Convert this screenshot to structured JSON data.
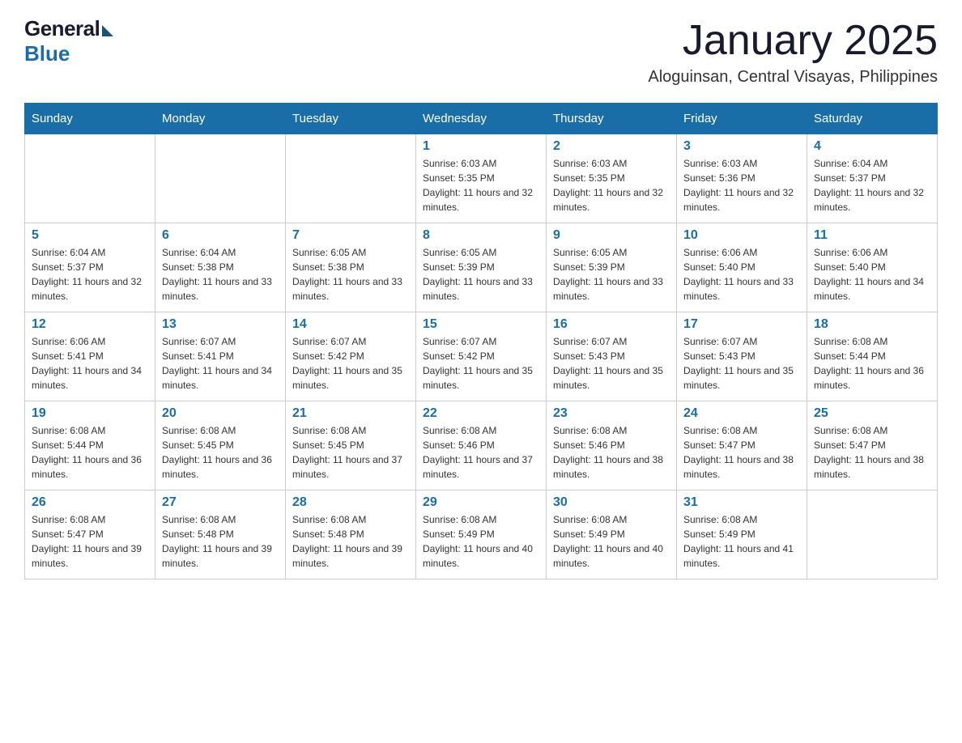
{
  "logo": {
    "general": "General",
    "blue": "Blue"
  },
  "header": {
    "month_year": "January 2025",
    "location": "Aloguinsan, Central Visayas, Philippines"
  },
  "weekdays": [
    "Sunday",
    "Monday",
    "Tuesday",
    "Wednesday",
    "Thursday",
    "Friday",
    "Saturday"
  ],
  "weeks": [
    [
      {
        "day": "",
        "sunrise": "",
        "sunset": "",
        "daylight": ""
      },
      {
        "day": "",
        "sunrise": "",
        "sunset": "",
        "daylight": ""
      },
      {
        "day": "",
        "sunrise": "",
        "sunset": "",
        "daylight": ""
      },
      {
        "day": "1",
        "sunrise": "Sunrise: 6:03 AM",
        "sunset": "Sunset: 5:35 PM",
        "daylight": "Daylight: 11 hours and 32 minutes."
      },
      {
        "day": "2",
        "sunrise": "Sunrise: 6:03 AM",
        "sunset": "Sunset: 5:35 PM",
        "daylight": "Daylight: 11 hours and 32 minutes."
      },
      {
        "day": "3",
        "sunrise": "Sunrise: 6:03 AM",
        "sunset": "Sunset: 5:36 PM",
        "daylight": "Daylight: 11 hours and 32 minutes."
      },
      {
        "day": "4",
        "sunrise": "Sunrise: 6:04 AM",
        "sunset": "Sunset: 5:37 PM",
        "daylight": "Daylight: 11 hours and 32 minutes."
      }
    ],
    [
      {
        "day": "5",
        "sunrise": "Sunrise: 6:04 AM",
        "sunset": "Sunset: 5:37 PM",
        "daylight": "Daylight: 11 hours and 32 minutes."
      },
      {
        "day": "6",
        "sunrise": "Sunrise: 6:04 AM",
        "sunset": "Sunset: 5:38 PM",
        "daylight": "Daylight: 11 hours and 33 minutes."
      },
      {
        "day": "7",
        "sunrise": "Sunrise: 6:05 AM",
        "sunset": "Sunset: 5:38 PM",
        "daylight": "Daylight: 11 hours and 33 minutes."
      },
      {
        "day": "8",
        "sunrise": "Sunrise: 6:05 AM",
        "sunset": "Sunset: 5:39 PM",
        "daylight": "Daylight: 11 hours and 33 minutes."
      },
      {
        "day": "9",
        "sunrise": "Sunrise: 6:05 AM",
        "sunset": "Sunset: 5:39 PM",
        "daylight": "Daylight: 11 hours and 33 minutes."
      },
      {
        "day": "10",
        "sunrise": "Sunrise: 6:06 AM",
        "sunset": "Sunset: 5:40 PM",
        "daylight": "Daylight: 11 hours and 33 minutes."
      },
      {
        "day": "11",
        "sunrise": "Sunrise: 6:06 AM",
        "sunset": "Sunset: 5:40 PM",
        "daylight": "Daylight: 11 hours and 34 minutes."
      }
    ],
    [
      {
        "day": "12",
        "sunrise": "Sunrise: 6:06 AM",
        "sunset": "Sunset: 5:41 PM",
        "daylight": "Daylight: 11 hours and 34 minutes."
      },
      {
        "day": "13",
        "sunrise": "Sunrise: 6:07 AM",
        "sunset": "Sunset: 5:41 PM",
        "daylight": "Daylight: 11 hours and 34 minutes."
      },
      {
        "day": "14",
        "sunrise": "Sunrise: 6:07 AM",
        "sunset": "Sunset: 5:42 PM",
        "daylight": "Daylight: 11 hours and 35 minutes."
      },
      {
        "day": "15",
        "sunrise": "Sunrise: 6:07 AM",
        "sunset": "Sunset: 5:42 PM",
        "daylight": "Daylight: 11 hours and 35 minutes."
      },
      {
        "day": "16",
        "sunrise": "Sunrise: 6:07 AM",
        "sunset": "Sunset: 5:43 PM",
        "daylight": "Daylight: 11 hours and 35 minutes."
      },
      {
        "day": "17",
        "sunrise": "Sunrise: 6:07 AM",
        "sunset": "Sunset: 5:43 PM",
        "daylight": "Daylight: 11 hours and 35 minutes."
      },
      {
        "day": "18",
        "sunrise": "Sunrise: 6:08 AM",
        "sunset": "Sunset: 5:44 PM",
        "daylight": "Daylight: 11 hours and 36 minutes."
      }
    ],
    [
      {
        "day": "19",
        "sunrise": "Sunrise: 6:08 AM",
        "sunset": "Sunset: 5:44 PM",
        "daylight": "Daylight: 11 hours and 36 minutes."
      },
      {
        "day": "20",
        "sunrise": "Sunrise: 6:08 AM",
        "sunset": "Sunset: 5:45 PM",
        "daylight": "Daylight: 11 hours and 36 minutes."
      },
      {
        "day": "21",
        "sunrise": "Sunrise: 6:08 AM",
        "sunset": "Sunset: 5:45 PM",
        "daylight": "Daylight: 11 hours and 37 minutes."
      },
      {
        "day": "22",
        "sunrise": "Sunrise: 6:08 AM",
        "sunset": "Sunset: 5:46 PM",
        "daylight": "Daylight: 11 hours and 37 minutes."
      },
      {
        "day": "23",
        "sunrise": "Sunrise: 6:08 AM",
        "sunset": "Sunset: 5:46 PM",
        "daylight": "Daylight: 11 hours and 38 minutes."
      },
      {
        "day": "24",
        "sunrise": "Sunrise: 6:08 AM",
        "sunset": "Sunset: 5:47 PM",
        "daylight": "Daylight: 11 hours and 38 minutes."
      },
      {
        "day": "25",
        "sunrise": "Sunrise: 6:08 AM",
        "sunset": "Sunset: 5:47 PM",
        "daylight": "Daylight: 11 hours and 38 minutes."
      }
    ],
    [
      {
        "day": "26",
        "sunrise": "Sunrise: 6:08 AM",
        "sunset": "Sunset: 5:47 PM",
        "daylight": "Daylight: 11 hours and 39 minutes."
      },
      {
        "day": "27",
        "sunrise": "Sunrise: 6:08 AM",
        "sunset": "Sunset: 5:48 PM",
        "daylight": "Daylight: 11 hours and 39 minutes."
      },
      {
        "day": "28",
        "sunrise": "Sunrise: 6:08 AM",
        "sunset": "Sunset: 5:48 PM",
        "daylight": "Daylight: 11 hours and 39 minutes."
      },
      {
        "day": "29",
        "sunrise": "Sunrise: 6:08 AM",
        "sunset": "Sunset: 5:49 PM",
        "daylight": "Daylight: 11 hours and 40 minutes."
      },
      {
        "day": "30",
        "sunrise": "Sunrise: 6:08 AM",
        "sunset": "Sunset: 5:49 PM",
        "daylight": "Daylight: 11 hours and 40 minutes."
      },
      {
        "day": "31",
        "sunrise": "Sunrise: 6:08 AM",
        "sunset": "Sunset: 5:49 PM",
        "daylight": "Daylight: 11 hours and 41 minutes."
      },
      {
        "day": "",
        "sunrise": "",
        "sunset": "",
        "daylight": ""
      }
    ]
  ]
}
